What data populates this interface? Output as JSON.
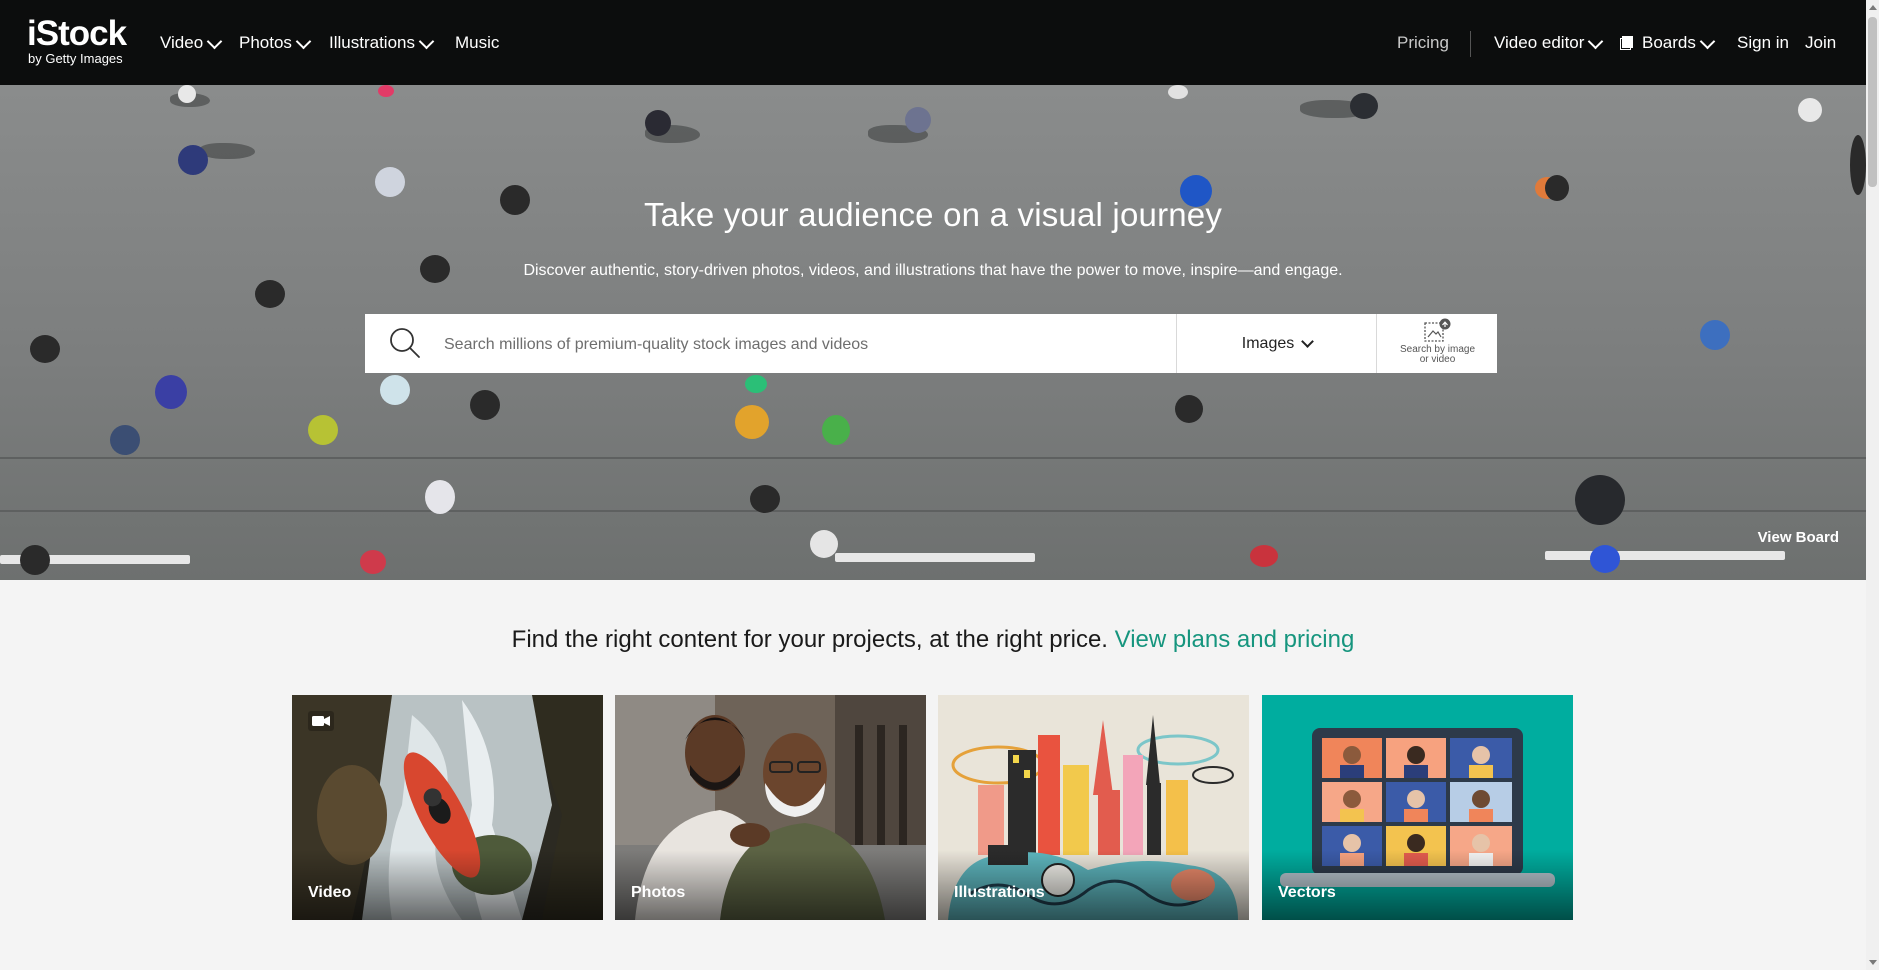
{
  "brand": {
    "name": "iStock",
    "sub": "by Getty Images"
  },
  "nav": {
    "left": [
      {
        "label": "Video",
        "dropdown": true
      },
      {
        "label": "Photos",
        "dropdown": true
      },
      {
        "label": "Illustrations",
        "dropdown": true
      },
      {
        "label": "Music",
        "dropdown": false
      }
    ],
    "pricing": "Pricing",
    "video_editor": "Video editor",
    "boards": "Boards",
    "sign_in": "Sign in",
    "join": "Join"
  },
  "hero": {
    "title": "Take your audience on a visual journey",
    "subtitle": "Discover authentic, story-driven photos, videos, and illustrations that have the power to move, inspire—and engage.",
    "search_placeholder": "Search millions of premium-quality stock images and videos",
    "search_type": "Images",
    "image_search_label_line1": "Search by image",
    "image_search_label_line2": "or video",
    "view_board": "View Board"
  },
  "pricing": {
    "text": "Find the right content for your projects, at the right price.",
    "link": "View plans and pricing",
    "link_color": "#16957e"
  },
  "tiles": [
    {
      "label": "Video",
      "icon": "video-camera-icon"
    },
    {
      "label": "Photos"
    },
    {
      "label": "Illustrations"
    },
    {
      "label": "Vectors"
    }
  ]
}
